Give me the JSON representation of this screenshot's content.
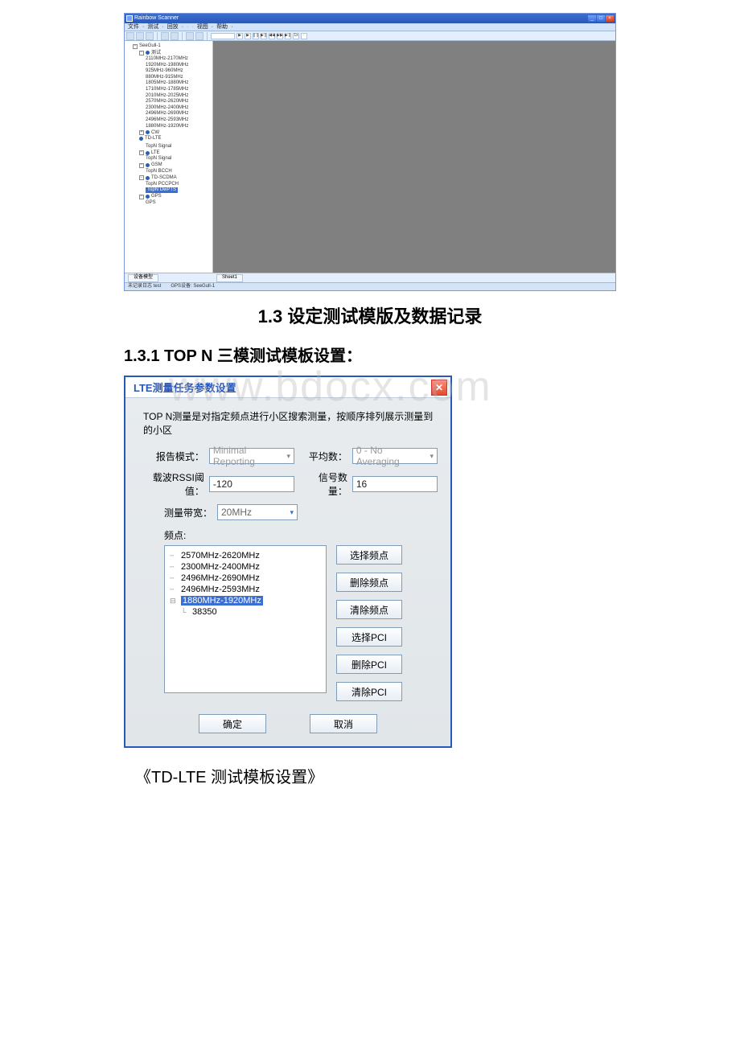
{
  "app": {
    "title": "Rainbow Scanner",
    "menus": {
      "file": "文件",
      "test": "测试",
      "playback": "回放",
      "dot1": "·",
      "dot2": "·",
      "view": "视图",
      "help": "帮助"
    },
    "toolbar_nav": {
      "n1": "▶",
      "n2": "▶",
      "n3": "❙❙",
      "n4": "▶❙",
      "n5": "◀◀",
      "n6": "▶▶",
      "n7": "▶❙",
      "n8": "1x",
      "n9": "·"
    },
    "tree_root": "SeeGull-1",
    "tree": {
      "rssi": "测试",
      "rssi_items": [
        "2110MHz-2170MHz",
        "1920MHz-1980MHz",
        "925MHz-960MHz",
        "880MHz-915MHz",
        "1805MHz-1880MHz",
        "1710MHz-1785MHz",
        "2010MHz-2025MHz",
        "2570MHz-2620MHz",
        "2300MHz-2400MHz",
        "2496MHz-2690MHz",
        "2496MHz-2593MHz",
        "1880MHz-1920MHz"
      ],
      "cw": "CW",
      "tdlte": "TD-LTE",
      "tdlte_child": "TopN Signal",
      "lte": "LTE",
      "lte_child": "TopN Signal",
      "gsm": "GSM",
      "gsm_child": "TopN BCCH",
      "tdscdma": "TD-SCDMA",
      "tdscdma_child": "TopN PCCPCH",
      "tdscdma_sel": "TopN DwPTS",
      "gps": "GPS",
      "gps_child": "GPS"
    },
    "sheet_tab": "Sheet1",
    "device_tab": "设备模型",
    "status_left": "未记录日志 test",
    "status_right": "GPS设备: SeeGull-1"
  },
  "headings": {
    "section": "1.3 设定测试模版及数据记录",
    "subsection": "1.3.1 TOP N 三模测试模板设置：",
    "caption": "《TD-LTE 测试模板设置》"
  },
  "watermark": "www.bdocx.com",
  "dialog": {
    "title": "LTE测量任务参数设置",
    "desc": "TOP N测量是对指定频点进行小区搜索测量，按顺序排列展示测量到的小区",
    "labels": {
      "report_mode": "报告模式：",
      "avg_count": "平均数：",
      "rssi_thresh": "载波RSSI阈值：",
      "signal_count": "信号数量：",
      "bandwidth": "测量带宽：",
      "freq": "频点:"
    },
    "values": {
      "report_mode": "Minimal Reporting",
      "avg_count": "0 - No Averaging",
      "rssi_thresh": "-120",
      "signal_count": "16",
      "bandwidth": "20MHz"
    },
    "freq_list": [
      "2570MHz-2620MHz",
      "2300MHz-2400MHz",
      "2496MHz-2690MHz",
      "2496MHz-2593MHz"
    ],
    "freq_selected": "1880MHz-1920MHz",
    "freq_child": "38350",
    "buttons": {
      "select_freq": "选择频点",
      "delete_freq": "删除频点",
      "clear_freq": "清除频点",
      "select_pci": "选择PCI",
      "delete_pci": "删除PCI",
      "clear_pci": "清除PCI",
      "ok": "确定",
      "cancel": "取消"
    }
  }
}
